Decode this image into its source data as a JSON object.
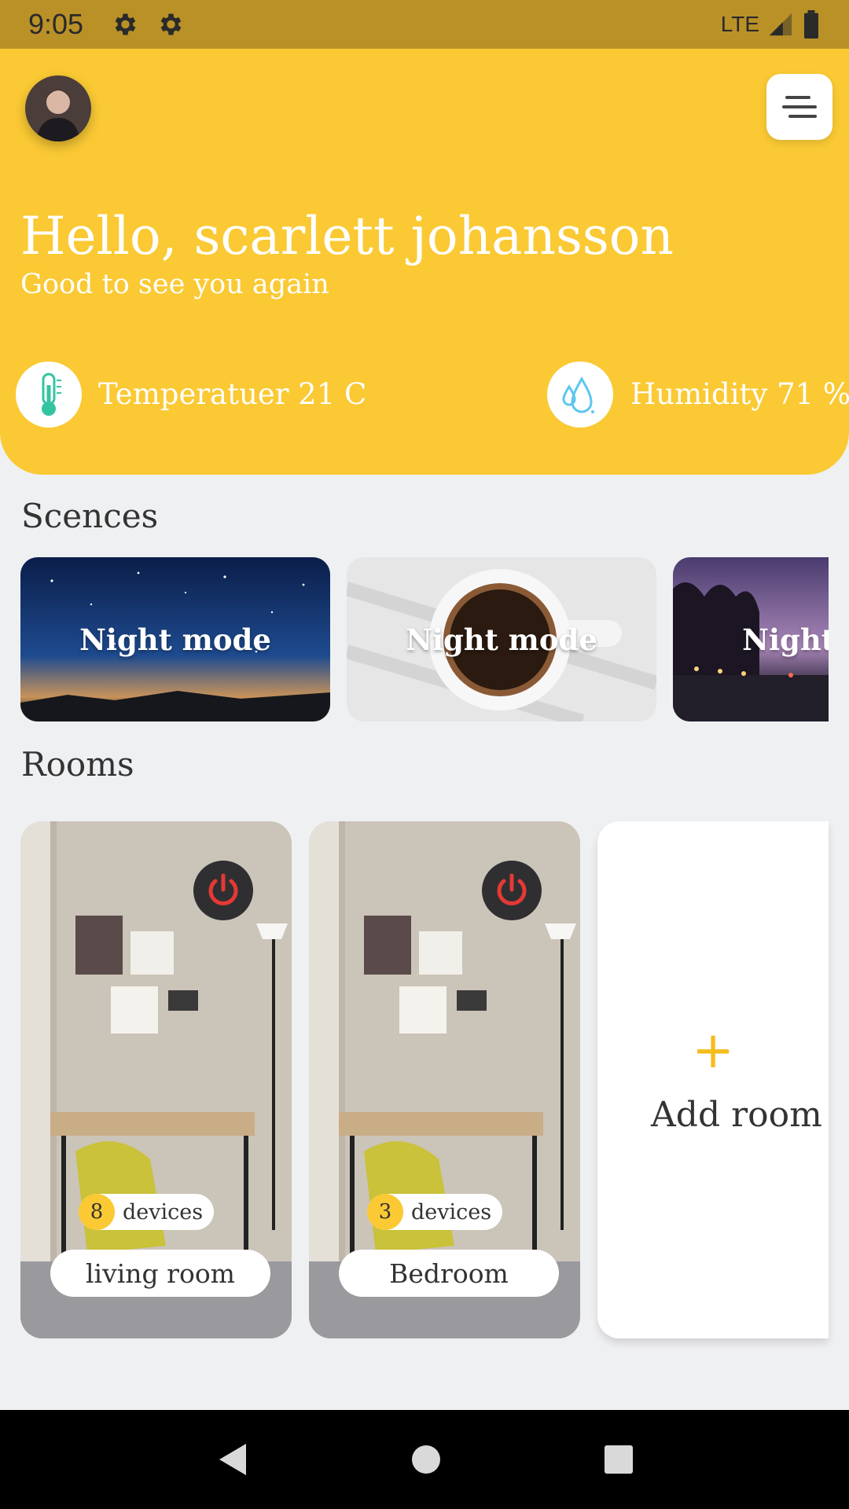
{
  "status_bar": {
    "time": "9:05",
    "network": "LTE"
  },
  "header": {
    "greeting": "Hello, scarlett johansson",
    "subtitle": "Good to see you again",
    "temperature": "Temperatuer 21 C",
    "humidity": "Humidity 71 %"
  },
  "scenes": {
    "title": "Scences",
    "items": [
      {
        "label": "Night mode",
        "image": "starry-night-sky"
      },
      {
        "label": "Night mode",
        "image": "coffee-cup"
      },
      {
        "label": "Night",
        "image": "evening-street"
      }
    ]
  },
  "rooms": {
    "title": "Rooms",
    "items": [
      {
        "name": "living room",
        "device_count": "8",
        "devices_label": "devices"
      },
      {
        "name": "Bedroom",
        "device_count": "3",
        "devices_label": "devices"
      }
    ],
    "add_label": "Add room",
    "add_icon": "+"
  },
  "colors": {
    "accent": "#fac934",
    "statusbar": "#b99127",
    "power": "#e53935"
  }
}
